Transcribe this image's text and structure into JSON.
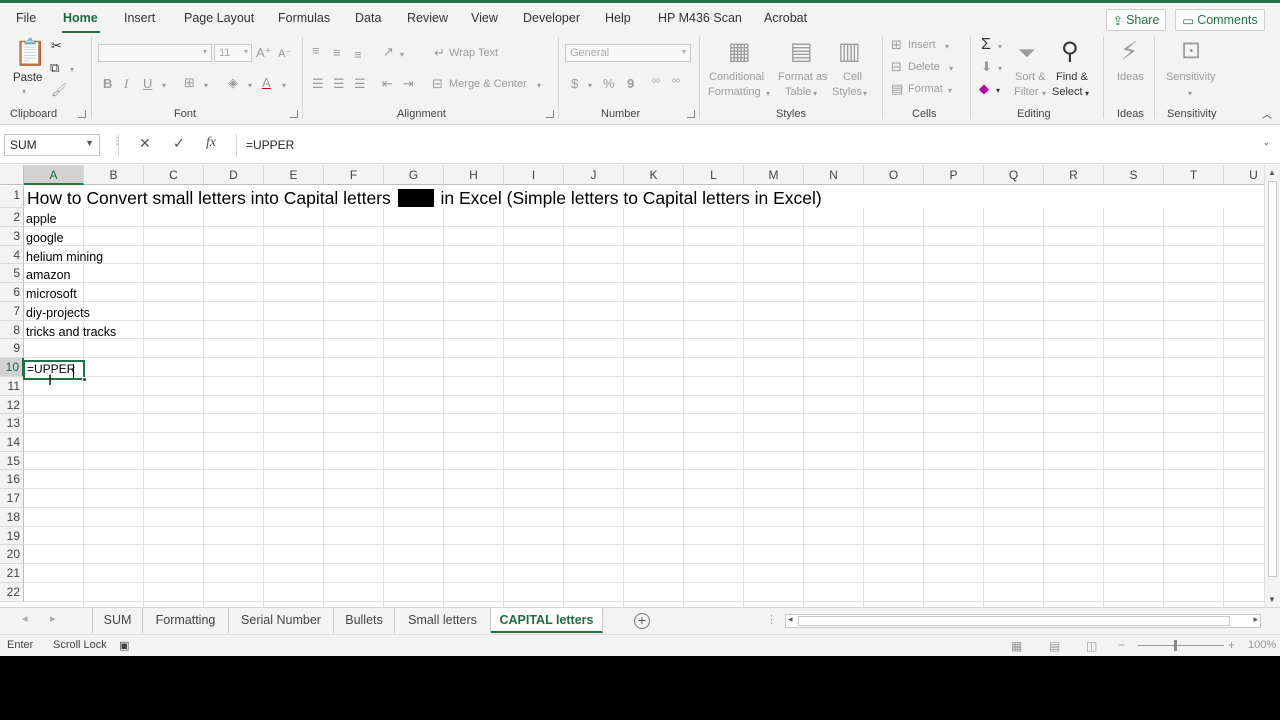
{
  "menu": {
    "tabs": [
      "File",
      "Home",
      "Insert",
      "Page Layout",
      "Formulas",
      "Data",
      "Review",
      "View",
      "Developer",
      "Help",
      "HP M436 Scan",
      "Acrobat"
    ],
    "active": "Home",
    "share": "Share",
    "comments": "Comments"
  },
  "ribbon": {
    "clipboard": {
      "label": "Clipboard",
      "paste": "Paste"
    },
    "font": {
      "label": "Font",
      "size": "11",
      "bold": "B",
      "italic": "I",
      "underline": "U"
    },
    "alignment": {
      "label": "Alignment",
      "wrap": "Wrap Text",
      "merge": "Merge & Center"
    },
    "number": {
      "label": "Number",
      "format": "General",
      "currency": "$",
      "percent": "%",
      "comma": "9"
    },
    "styles": {
      "label": "Styles",
      "conditional": "Conditional",
      "conditional2": "Formatting",
      "format_table": "Format as",
      "format_table2": "Table",
      "cell_styles": "Cell",
      "cell_styles2": "Styles"
    },
    "cells": {
      "label": "Cells",
      "insert": "Insert",
      "delete": "Delete",
      "format": "Format"
    },
    "editing": {
      "label": "Editing",
      "sort": "Sort &",
      "sort2": "Filter",
      "find": "Find &",
      "find2": "Select"
    },
    "ideas": {
      "label": "Ideas",
      "button": "Ideas"
    },
    "sensitivity": {
      "label": "Sensitivity",
      "button": "Sensitivity"
    }
  },
  "formula_bar": {
    "name_box": "SUM",
    "cancel": "✕",
    "enter": "✓",
    "fx": "fx",
    "formula": "=UPPER"
  },
  "grid": {
    "columns": [
      "A",
      "B",
      "C",
      "D",
      "E",
      "F",
      "G",
      "H",
      "I",
      "J",
      "K",
      "L",
      "M",
      "N",
      "O",
      "P",
      "Q",
      "R",
      "S",
      "T",
      "U"
    ],
    "rows": [
      "1",
      "2",
      "3",
      "4",
      "5",
      "6",
      "7",
      "8",
      "9",
      "10",
      "11",
      "12",
      "13",
      "14",
      "15",
      "16",
      "17",
      "18",
      "19",
      "20",
      "21",
      "22"
    ],
    "title_part1": "How to Convert small letters into Capital letters",
    "title_part2": "in Excel (Simple letters to Capital letters in Excel)",
    "cells_col_a": [
      "apple",
      "google",
      "helium mining",
      "amazon",
      "microsoft",
      "diy-projects",
      "tricks and tracks"
    ],
    "active_cell_value": "=UPPER"
  },
  "sheets": {
    "tabs": [
      "SUM",
      "Formatting",
      "Serial Number",
      "Bullets",
      "Small letters",
      "CAPITAL letters"
    ],
    "active": "CAPITAL letters"
  },
  "status": {
    "mode": "Enter",
    "scroll_lock": "Scroll Lock",
    "zoom": "100%"
  }
}
